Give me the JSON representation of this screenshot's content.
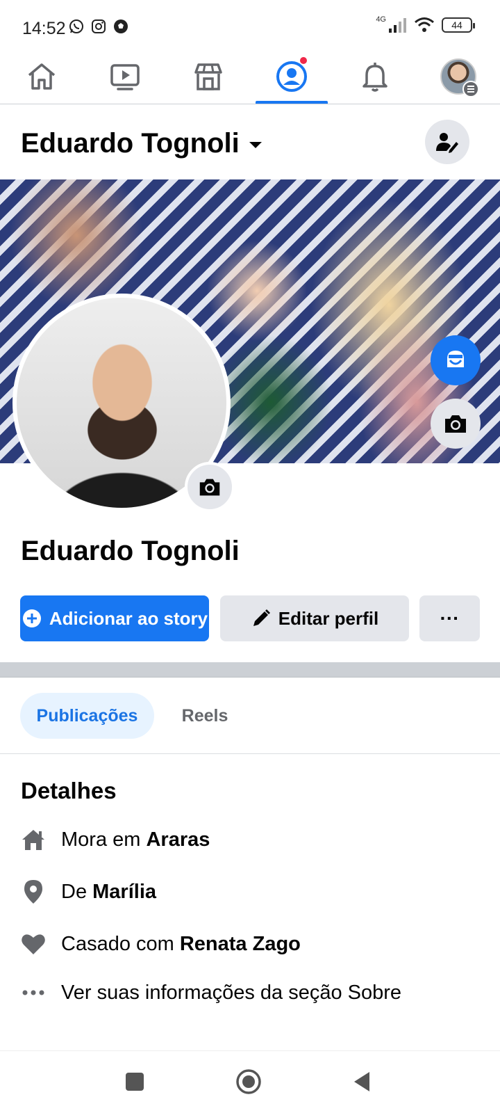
{
  "status_bar": {
    "time": "14:52",
    "network": "4G",
    "battery": "44",
    "app_icons": [
      "whatsapp-icon",
      "instagram-icon",
      "soccer-ball-icon"
    ]
  },
  "nav": {
    "tabs": [
      {
        "name": "home",
        "icon": "home-icon"
      },
      {
        "name": "video",
        "icon": "video-icon"
      },
      {
        "name": "marketplace",
        "icon": "marketplace-icon",
        "notification": true
      },
      {
        "name": "profile",
        "icon": "profile-icon",
        "active": true
      },
      {
        "name": "notifications",
        "icon": "bell-icon"
      },
      {
        "name": "menu",
        "icon": "avatar-icon"
      }
    ],
    "accent_color": "#1877f2",
    "notification_color": "#f02849"
  },
  "header": {
    "name": "Eduardo Tognoli"
  },
  "profile": {
    "name": "Eduardo Tognoli"
  },
  "actions": {
    "story_label": "Adicionar ao story",
    "edit_label": "Editar perfil",
    "more_label": "···"
  },
  "content_tabs": [
    {
      "label": "Publicações",
      "active": true
    },
    {
      "label": "Reels",
      "active": false
    }
  ],
  "details": {
    "title": "Detalhes",
    "items": [
      {
        "icon": "home-icon",
        "prefix": "Mora em ",
        "bold": "Araras"
      },
      {
        "icon": "location-pin-icon",
        "prefix": "De ",
        "bold": "Marília"
      },
      {
        "icon": "heart-icon",
        "prefix": "Casado com ",
        "bold": "Renata Zago"
      },
      {
        "icon": "ellipsis-icon",
        "prefix": "Ver suas informações da seção Sobre",
        "bold": ""
      }
    ]
  },
  "colors": {
    "primary": "#1877f2",
    "secondary_button": "#e4e6eb",
    "tab_active_bg": "#e7f3ff",
    "tab_active_text": "#1b74e4",
    "muted_icon": "#65676b"
  }
}
